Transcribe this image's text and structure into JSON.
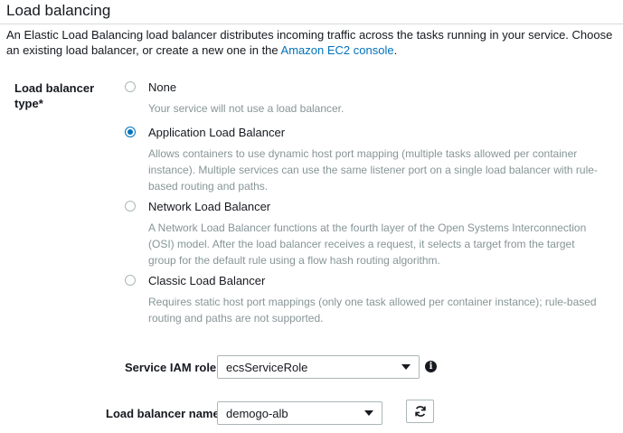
{
  "section": {
    "title": "Load balancing",
    "intro_text": "An Elastic Load Balancing load balancer distributes incoming traffic across the tasks running in your service. Choose an existing load balancer, or create a new one in the ",
    "intro_link": "Amazon EC2 console",
    "intro_end": "."
  },
  "lb_type": {
    "label": "Load balancer type*",
    "options": [
      {
        "label": "None",
        "description": "Your service will not use a load balancer.",
        "selected": false
      },
      {
        "label": "Application Load Balancer",
        "description": "Allows containers to use dynamic host port mapping (multiple tasks allowed per container instance). Multiple services can use the same listener port on a single load balancer with rule-based routing and paths.",
        "selected": true
      },
      {
        "label": "Network Load Balancer",
        "description": "A Network Load Balancer functions at the fourth layer of the Open Systems Interconnection (OSI) model. After the load balancer receives a request, it selects a target from the target group for the default rule using a flow hash routing algorithm.",
        "selected": false
      },
      {
        "label": "Classic Load Balancer",
        "description": "Requires static host port mappings (only one task allowed per container instance); rule-based routing and paths are not supported.",
        "selected": false
      }
    ]
  },
  "service_iam_role": {
    "label": "Service IAM role",
    "value": "ecsServiceRole",
    "info_icon": "info-icon"
  },
  "load_balancer_name": {
    "label": "Load balancer name",
    "value": "demogo-alb",
    "refresh_icon": "refresh-icon"
  },
  "colors": {
    "link": "#0073bb",
    "radio_selected": "#0073bb",
    "description_text": "#879596",
    "border": "#aab7b8"
  }
}
